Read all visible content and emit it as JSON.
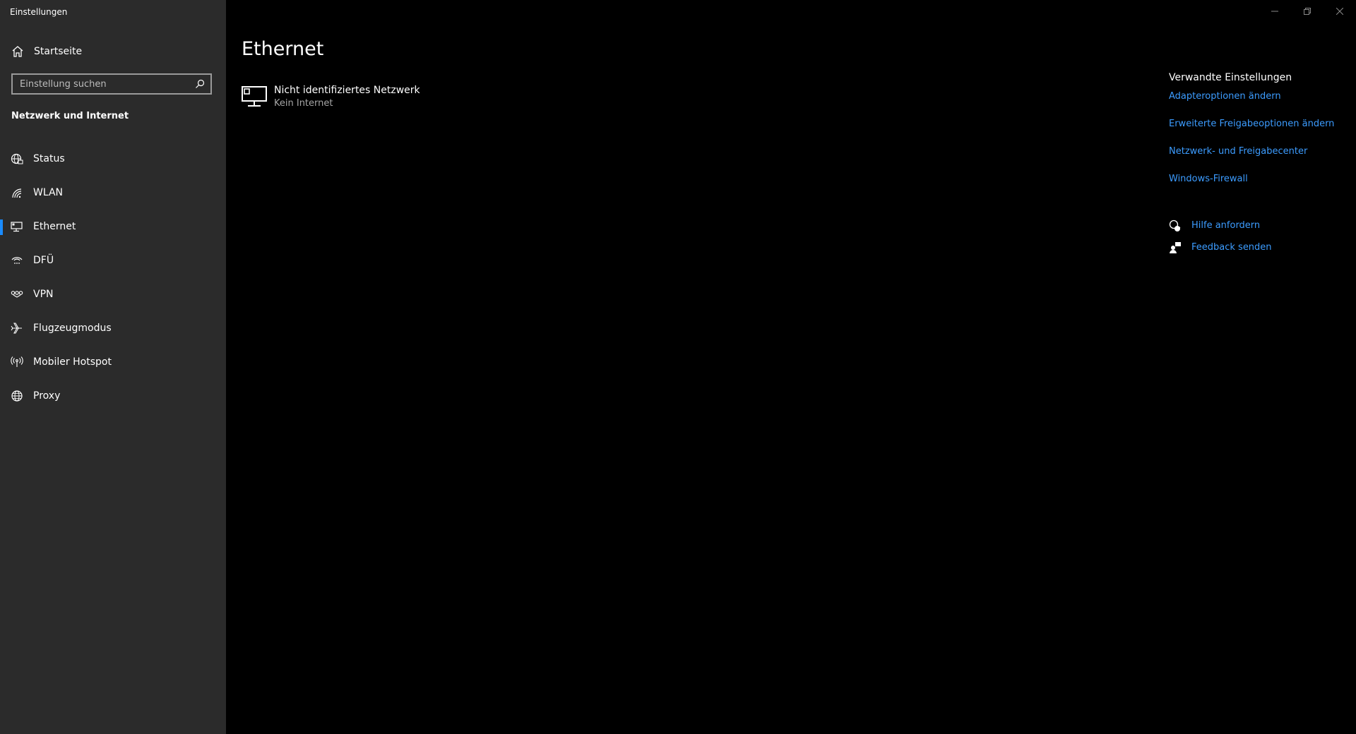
{
  "window": {
    "title": "Einstellungen"
  },
  "sidebar": {
    "home_label": "Startseite",
    "search_placeholder": "Einstellung suchen",
    "section_title": "Netzwerk und Internet",
    "items": [
      {
        "label": "Status",
        "icon": "globe-status-icon"
      },
      {
        "label": "WLAN",
        "icon": "wifi-icon"
      },
      {
        "label": "Ethernet",
        "icon": "ethernet-icon",
        "selected": true
      },
      {
        "label": "DFÜ",
        "icon": "dialup-icon"
      },
      {
        "label": "VPN",
        "icon": "vpn-icon"
      },
      {
        "label": "Flugzeugmodus",
        "icon": "airplane-icon"
      },
      {
        "label": "Mobiler Hotspot",
        "icon": "hotspot-icon"
      },
      {
        "label": "Proxy",
        "icon": "globe-icon"
      }
    ]
  },
  "main": {
    "title": "Ethernet",
    "network": {
      "name": "Nicht identifiziertes Netzwerk",
      "status": "Kein Internet"
    }
  },
  "related": {
    "title": "Verwandte Einstellungen",
    "links": [
      "Adapteroptionen ändern",
      "Erweiterte Freigabeoptionen ändern",
      "Netzwerk- und Freigabecenter",
      "Windows-Firewall"
    ],
    "help": {
      "get_help": "Hilfe anfordern",
      "feedback": "Feedback senden"
    }
  },
  "colors": {
    "sidebar_bg": "#2b2b2b",
    "main_bg": "#000000",
    "accent": "#1a8cff",
    "link": "#3c9cff"
  }
}
